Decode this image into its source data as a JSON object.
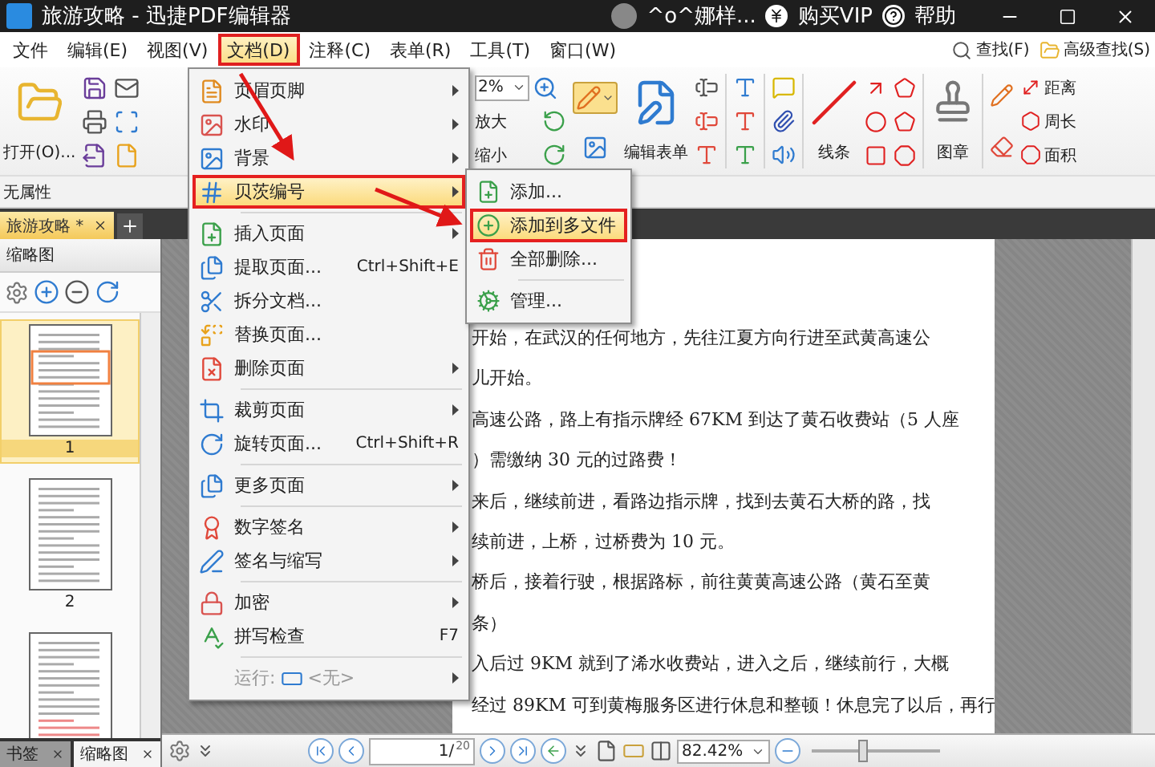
{
  "window": {
    "title": "旅游攻略 - 迅捷PDF编辑器",
    "user": "^o^娜样...",
    "vip": "购买VIP",
    "help": "帮助"
  },
  "menu_bar": [
    {
      "label": "文件",
      "selected": false
    },
    {
      "label": "编辑(E)",
      "selected": false
    },
    {
      "label": "视图(V)",
      "selected": false
    },
    {
      "label": "文档(D)",
      "selected": true
    },
    {
      "label": "注释(C)",
      "selected": false
    },
    {
      "label": "表单(R)",
      "selected": false
    },
    {
      "label": "工具(T)",
      "selected": false
    },
    {
      "label": "窗口(W)",
      "selected": false
    }
  ],
  "search": [
    {
      "label": "查找(F)"
    },
    {
      "label": "高级查找(S)"
    }
  ],
  "ribbon": {
    "open": "打开(O)...",
    "zoom_value": "2%",
    "zoom_in": "放大",
    "zoom_out": "缩小",
    "edit_form": "编辑表单",
    "line": "线条",
    "stamp": "图章",
    "measure": [
      "距离",
      "周长",
      "面积"
    ]
  },
  "properties": "无属性",
  "doc_tabs": [
    {
      "label": "旅游攻略 *",
      "selected": true
    }
  ],
  "left_panel": {
    "title": "缩略图",
    "thumbnails": [
      {
        "label": "1",
        "selected": true
      },
      {
        "label": "2",
        "selected": false
      },
      {
        "selected": false
      }
    ],
    "bottom_tabs": [
      {
        "label": "书签",
        "selected": false
      },
      {
        "label": "缩略图",
        "selected": true
      }
    ]
  },
  "document": {
    "lines": [
      "开始，在武汉的任何地方，先往江夏方向行进至武黄高速公",
      "儿开始。",
      "高速公路，路上有指示牌经 67KM 到达了黄石收费站（5 人座",
      "）需缴纳 30 元的过路费！",
      "来后，继续前进，看路边指示牌，找到去黄石大桥的路，找",
      "续前进，上桥，过桥费为 10 元。",
      "桥后，接着行驶，根据路标，前往黄黄高速公路（黄石至黄",
      "条）",
      "入后过 9KM 就到了浠水收费站，进入之后，继续前行，大概",
      "经过 89KM 可到黄梅服务区进行休息和整顿！休息完了以后，再行"
    ]
  },
  "nav": {
    "page": "1",
    "page_sep": "/",
    "total": "20",
    "zoom": "82.42%",
    "zoom_slider": {
      "level": 0.4
    }
  },
  "doc_menu": {
    "items": [
      {
        "kind": "item",
        "label": "页眉页脚",
        "submenu": true,
        "selected": false,
        "disabled": false
      },
      {
        "kind": "item",
        "label": "水印",
        "submenu": true,
        "selected": false,
        "disabled": false
      },
      {
        "kind": "item",
        "label": "背景",
        "submenu": true,
        "selected": false,
        "disabled": false
      },
      {
        "kind": "item",
        "label": "贝茨编号",
        "submenu": true,
        "selected": true,
        "disabled": false
      },
      {
        "kind": "separator"
      },
      {
        "kind": "item",
        "label": "插入页面",
        "submenu": true,
        "selected": false,
        "disabled": false
      },
      {
        "kind": "item",
        "label": "提取页面...",
        "shortcut": "Ctrl+Shift+E",
        "submenu": false,
        "selected": false,
        "disabled": false
      },
      {
        "kind": "item",
        "label": "拆分文档...",
        "submenu": false,
        "selected": false,
        "disabled": false
      },
      {
        "kind": "item",
        "label": "替换页面...",
        "submenu": false,
        "selected": false,
        "disabled": false
      },
      {
        "kind": "item",
        "label": "删除页面",
        "submenu": true,
        "selected": false,
        "disabled": false
      },
      {
        "kind": "separator"
      },
      {
        "kind": "item",
        "label": "裁剪页面",
        "submenu": true,
        "selected": false,
        "disabled": false
      },
      {
        "kind": "item",
        "label": "旋转页面...",
        "shortcut": "Ctrl+Shift+R",
        "submenu": false,
        "selected": false,
        "disabled": false
      },
      {
        "kind": "separator"
      },
      {
        "kind": "item",
        "label": "更多页面",
        "submenu": true,
        "selected": false,
        "disabled": false
      },
      {
        "kind": "separator"
      },
      {
        "kind": "item",
        "label": "数字签名",
        "submenu": true,
        "selected": false,
        "disabled": false
      },
      {
        "kind": "item",
        "label": "签名与缩写",
        "submenu": true,
        "selected": false,
        "disabled": false
      },
      {
        "kind": "separator"
      },
      {
        "kind": "item",
        "label": "加密",
        "submenu": true,
        "selected": false,
        "disabled": false
      },
      {
        "kind": "item",
        "label": "拼写检查",
        "shortcut": "F7",
        "submenu": false,
        "selected": false,
        "disabled": false
      },
      {
        "kind": "separator"
      },
      {
        "kind": "run",
        "label": "运行:",
        "value": "<无>",
        "submenu": true,
        "selected": false,
        "disabled": true
      }
    ]
  },
  "submenu": {
    "items": [
      {
        "kind": "item",
        "label": "添加...",
        "selected": false
      },
      {
        "kind": "item",
        "label": "添加到多文件",
        "selected": true
      },
      {
        "kind": "item",
        "label": "全部删除...",
        "selected": false
      },
      {
        "kind": "separator"
      },
      {
        "kind": "item",
        "label": "管理...",
        "selected": false
      }
    ]
  }
}
